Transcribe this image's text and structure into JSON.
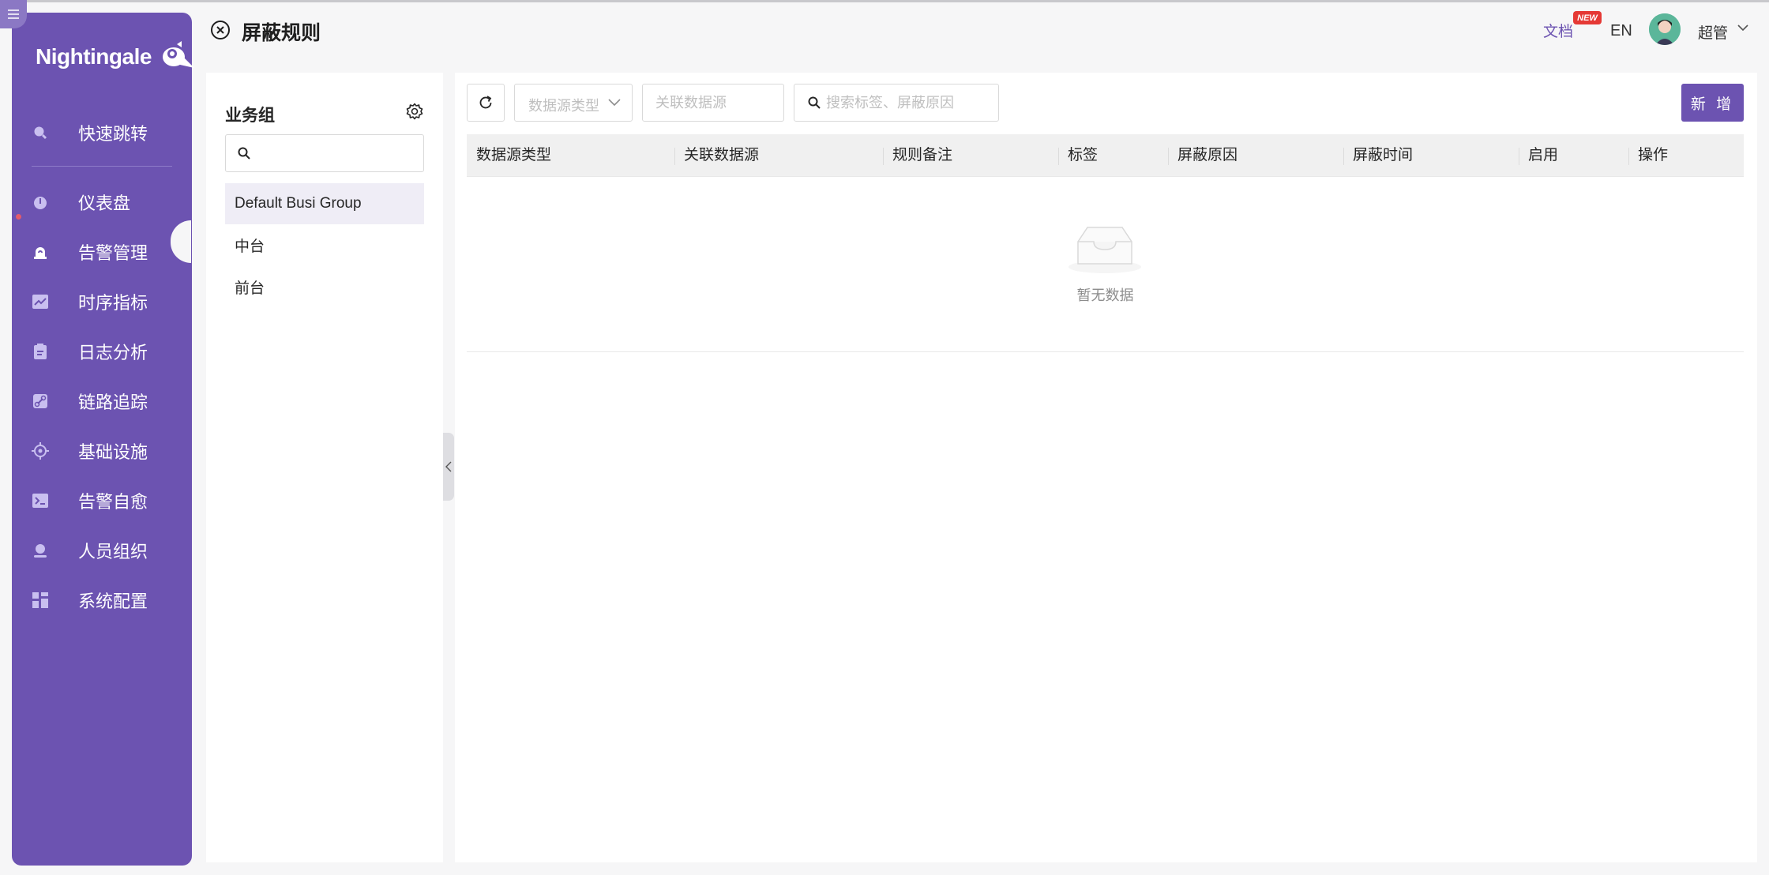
{
  "app": {
    "logo_text": "Nightingale"
  },
  "sidebar": {
    "items": [
      {
        "label": "快速跳转",
        "icon": "search-icon"
      },
      {
        "label": "仪表盘",
        "icon": "dashboard-icon"
      },
      {
        "label": "告警管理",
        "icon": "alarm-icon",
        "active": true
      },
      {
        "label": "时序指标",
        "icon": "line-chart-icon"
      },
      {
        "label": "日志分析",
        "icon": "log-icon"
      },
      {
        "label": "链路追踪",
        "icon": "link-icon"
      },
      {
        "label": "基础设施",
        "icon": "target-icon"
      },
      {
        "label": "告警自愈",
        "icon": "terminal-icon"
      },
      {
        "label": "人员组织",
        "icon": "user-icon"
      },
      {
        "label": "系统配置",
        "icon": "settings-grid-icon"
      }
    ]
  },
  "header": {
    "title": "屏蔽规则",
    "doc_label": "文档",
    "new_badge": "NEW",
    "lang": "EN",
    "user_name": "超管"
  },
  "business_groups": {
    "title": "业务组",
    "search_placeholder": "",
    "items": [
      {
        "label": "Default Busi Group",
        "active": true
      },
      {
        "label": "中台"
      },
      {
        "label": "前台"
      }
    ]
  },
  "toolbar": {
    "datasource_type_placeholder": "数据源类型",
    "related_datasource_placeholder": "关联数据源",
    "search_placeholder": "搜索标签、屏蔽原因",
    "add_label": "新 增"
  },
  "table": {
    "columns": [
      "数据源类型",
      "关联数据源",
      "规则备注",
      "标签",
      "屏蔽原因",
      "屏蔽时间",
      "启用",
      "操作"
    ],
    "rows": [],
    "empty_text": "暂无数据"
  },
  "colors": {
    "brand": "#6c53b1",
    "badge": "#e53935"
  }
}
